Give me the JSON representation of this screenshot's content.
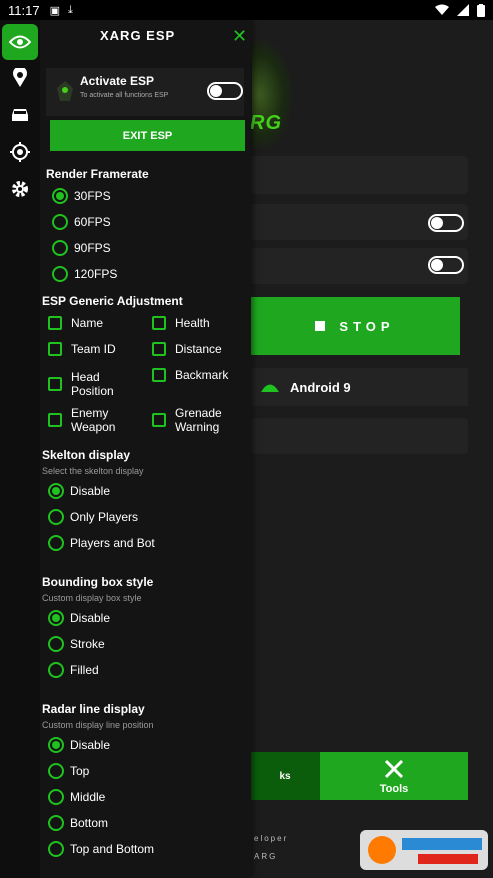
{
  "status_bar": {
    "time": "11:17"
  },
  "drawer": {
    "title": "XARG ESP",
    "activate": {
      "title": "Activate ESP",
      "subtitle": "To activate all functions ESP"
    },
    "exit_button": "EXIT ESP",
    "render": {
      "title": "Render Framerate",
      "options": [
        "30FPS",
        "60FPS",
        "90FPS",
        "120FPS"
      ],
      "selected": "30FPS"
    },
    "generic": {
      "title": "ESP Generic Adjustment",
      "items": [
        "Name",
        "Health",
        "Team ID",
        "Distance",
        "Head Position",
        "Backmark",
        "Enemy Weapon",
        "Grenade Warning"
      ]
    },
    "skelton": {
      "title": "Skelton display",
      "subtitle": "Select the skelton display",
      "options": [
        "Disable",
        "Only Players",
        "Players and Bot"
      ],
      "selected": "Disable"
    },
    "bbox": {
      "title": "Bounding box style",
      "subtitle": "Custom display box style",
      "options": [
        "Disable",
        "Stroke",
        "Filled"
      ],
      "selected": "Disable"
    },
    "radar": {
      "title": "Radar line display",
      "subtitle": "Custom display line position",
      "options": [
        "Disable",
        "Top",
        "Middle",
        "Bottom",
        "Top and Bottom"
      ],
      "selected": "Disable"
    }
  },
  "background": {
    "logo_text": "RG",
    "stop_label": "STOP",
    "android_label": "Android 9",
    "nav_left_label": "ks",
    "nav_tools_label": "Tools",
    "dev_line1": "eloper",
    "dev_line2": "ARG"
  },
  "colors": {
    "accent": "#1fa81f",
    "accent_bright": "#1fc21f",
    "bg": "#141414"
  }
}
